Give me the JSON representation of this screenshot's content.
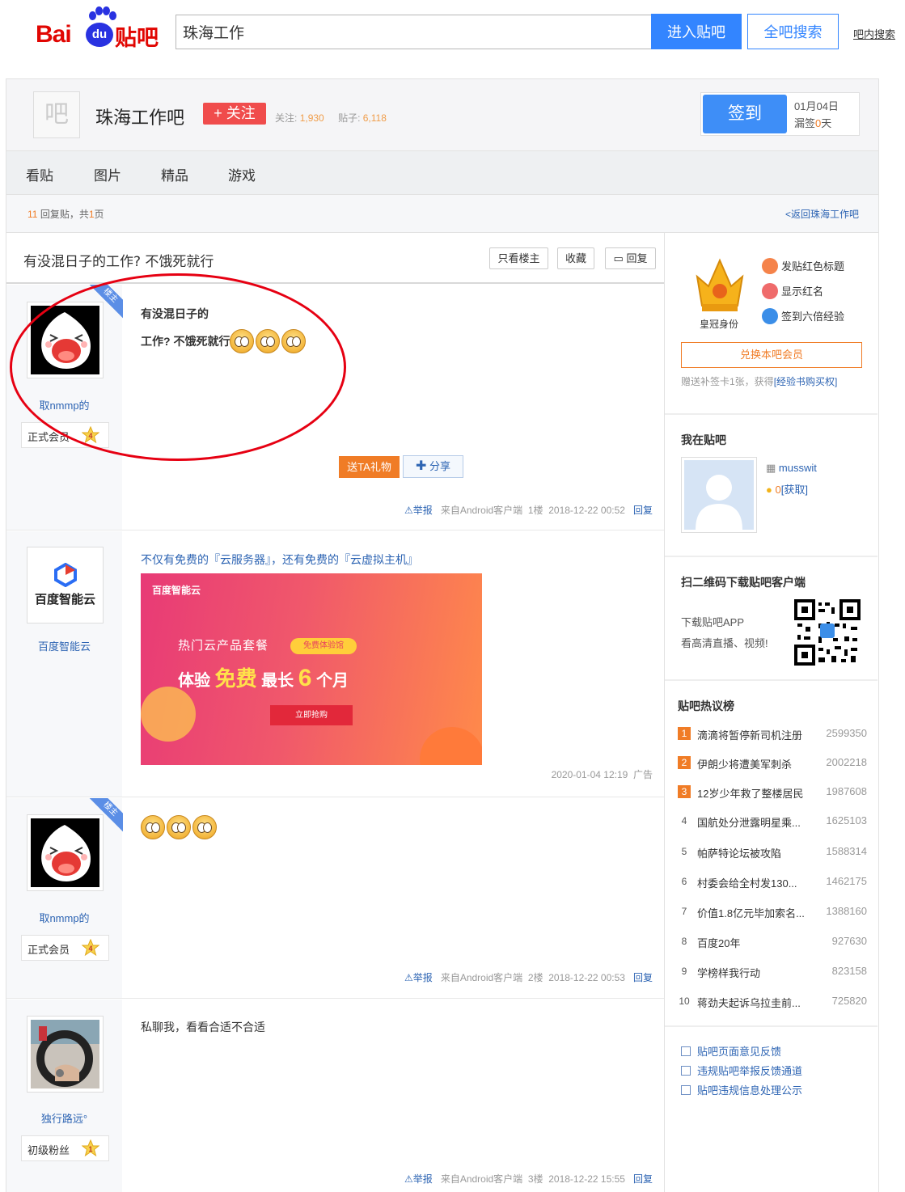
{
  "header": {
    "logo_text": "Bai du 贴吧",
    "search_value": "珠海工作",
    "enter_label": "进入贴吧",
    "all_label": "全吧搜索",
    "inner_label": "吧内搜索"
  },
  "forum": {
    "avatar_char": "吧",
    "name": "珠海工作吧",
    "follow_label": "+ 关注",
    "follow_text": "关注:",
    "follow_count": "1,930",
    "post_text": "贴子:",
    "post_count": "6,118",
    "checkin_label": "签到",
    "date": "01月04日",
    "miss_prefix": "漏签",
    "miss_days": "0",
    "miss_suffix": "天"
  },
  "nav": [
    "看贴",
    "图片",
    "精品",
    "游戏"
  ],
  "pager": {
    "count": "11",
    "text_a": "回复贴，共",
    "pages": "1",
    "text_b": "页",
    "back": "<返回珠海工作吧"
  },
  "thread": {
    "title": "有没混日子的工作? 不饿死就行",
    "btn_only": "只看楼主",
    "btn_fav": "收藏",
    "btn_reply": "回复"
  },
  "floors": [
    {
      "user": "取nmmp的",
      "level_name": "正式会员",
      "level": "4",
      "corner": "楼主",
      "line1": "有没混日子的",
      "line2": "工作? 不饿死就行",
      "gift": "送TA礼物",
      "share": "分享",
      "report": "举报",
      "source": "来自Android客户端",
      "floor": "1楼",
      "time": "2018-12-22 00:52",
      "reply": "回复"
    },
    {
      "ad_text": "不仅有免费的『云服务器』，还有免费的『云虚拟主机』",
      "ad_logo": "百度智能云",
      "ad_user": "百度智能云",
      "ad_banner_logo": "百度智能云",
      "ad_line1": "热门云产品套餐",
      "ad_tag": "免费体验馆",
      "ad_exp": "体验",
      "ad_free": "免费",
      "ad_longest": "最长",
      "ad_six": "6",
      "ad_month": "个月",
      "ad_buy": "立即抢购",
      "ad_time": "2020-01-04 12:19",
      "ad_label": "广告"
    },
    {
      "user": "取nmmp的",
      "level_name": "正式会员",
      "level": "4",
      "corner": "楼主",
      "report": "举报",
      "source": "来自Android客户端",
      "floor": "2楼",
      "time": "2018-12-22 00:53",
      "reply": "回复"
    },
    {
      "user": "独行路远°",
      "level_name": "初级粉丝",
      "level": "1",
      "text": "私聊我，看看合适不合适",
      "report": "举报",
      "source": "来自Android客户端",
      "floor": "3楼",
      "time": "2018-12-22 15:55",
      "reply": "回复"
    }
  ],
  "sidebar": {
    "crown_label": "皇冠身份",
    "perk1": "发贴红色标题",
    "perk2": "显示红名",
    "perk3": "签到六倍经验",
    "vip_btn": "兑换本吧会员",
    "vip_note_a": "赠送补签卡1张，获得",
    "vip_note_link": "[经验书购买权]",
    "mine_head": "我在贴吧",
    "username": "musswit",
    "coins": "0",
    "get": "[获取]",
    "qr_head": "扫二维码下载贴吧客户端",
    "qr_line1": "下载贴吧APP",
    "qr_line2": "看高清直播、视频!",
    "hot_head": "贴吧热议榜",
    "hot": [
      {
        "i": "1",
        "t": "滴滴将暂停新司机注册",
        "c": "2599350"
      },
      {
        "i": "2",
        "t": "伊朗少将遭美军刺杀",
        "c": "2002218"
      },
      {
        "i": "3",
        "t": "12岁少年救了整楼居民",
        "c": "1987608"
      },
      {
        "i": "4",
        "t": "国航处分泄露明星乘...",
        "c": "1625103"
      },
      {
        "i": "5",
        "t": "帕萨特论坛被攻陷",
        "c": "1588314"
      },
      {
        "i": "6",
        "t": "村委会给全村发130...",
        "c": "1462175"
      },
      {
        "i": "7",
        "t": "价值1.8亿元毕加索名...",
        "c": "1388160"
      },
      {
        "i": "8",
        "t": "百度20年",
        "c": "927630"
      },
      {
        "i": "9",
        "t": "学榜样我行动",
        "c": "823158"
      },
      {
        "i": "10",
        "t": "蒋劲夫起诉乌拉圭前...",
        "c": "725820"
      }
    ],
    "fb1": "贴吧页面意见反馈",
    "fb2": "违规贴吧举报反馈通道",
    "fb3": "贴吧违规信息处理公示"
  },
  "colors": {
    "brand_red": "#e10602",
    "brand_blue": "#3385ff",
    "accent_orange": "#f07c26",
    "link_blue": "#2d64b3"
  }
}
